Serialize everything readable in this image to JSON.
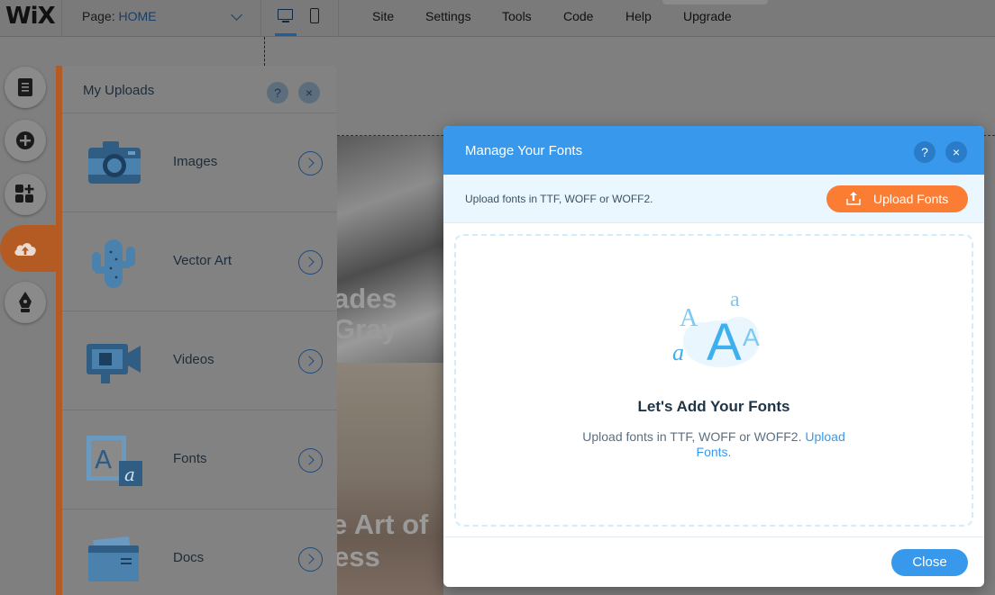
{
  "topbar": {
    "logo": "WiX",
    "page_label": "Page:",
    "page_value": "HOME",
    "menu": [
      "Site",
      "Settings",
      "Tools",
      "Code",
      "Help",
      "Upgrade"
    ]
  },
  "background_site": {
    "text1": "ades",
    "text2": "Gray",
    "text3": "e Art of",
    "text4": "ess"
  },
  "rail": {
    "items": [
      "pages-icon",
      "add-icon",
      "apps-icon",
      "upload-icon",
      "pen-icon"
    ],
    "active": "upload-icon"
  },
  "uploads_panel": {
    "title": "My Uploads",
    "help": "?",
    "close": "×",
    "items": [
      {
        "label": "Images",
        "icon": "camera-icon"
      },
      {
        "label": "Vector Art",
        "icon": "cactus-icon"
      },
      {
        "label": "Videos",
        "icon": "video-camera-icon"
      },
      {
        "label": "Fonts",
        "icon": "font-frame-icon"
      },
      {
        "label": "Docs",
        "icon": "folder-icon"
      }
    ]
  },
  "modal": {
    "title": "Manage Your Fonts",
    "help": "?",
    "close_x": "×",
    "subtitle": "Upload fonts in TTF, WOFF or WOFF2.",
    "upload_button": "Upload Fonts",
    "dropzone_title": "Let's Add Your Fonts",
    "dropzone_text": "Upload fonts in TTF, WOFF or WOFF2.",
    "dropzone_link": "Upload Fonts.",
    "close_button": "Close"
  },
  "colors": {
    "accent_blue": "#3899ec",
    "orange": "#fb7d33",
    "rail_orange": "#b45b23"
  }
}
